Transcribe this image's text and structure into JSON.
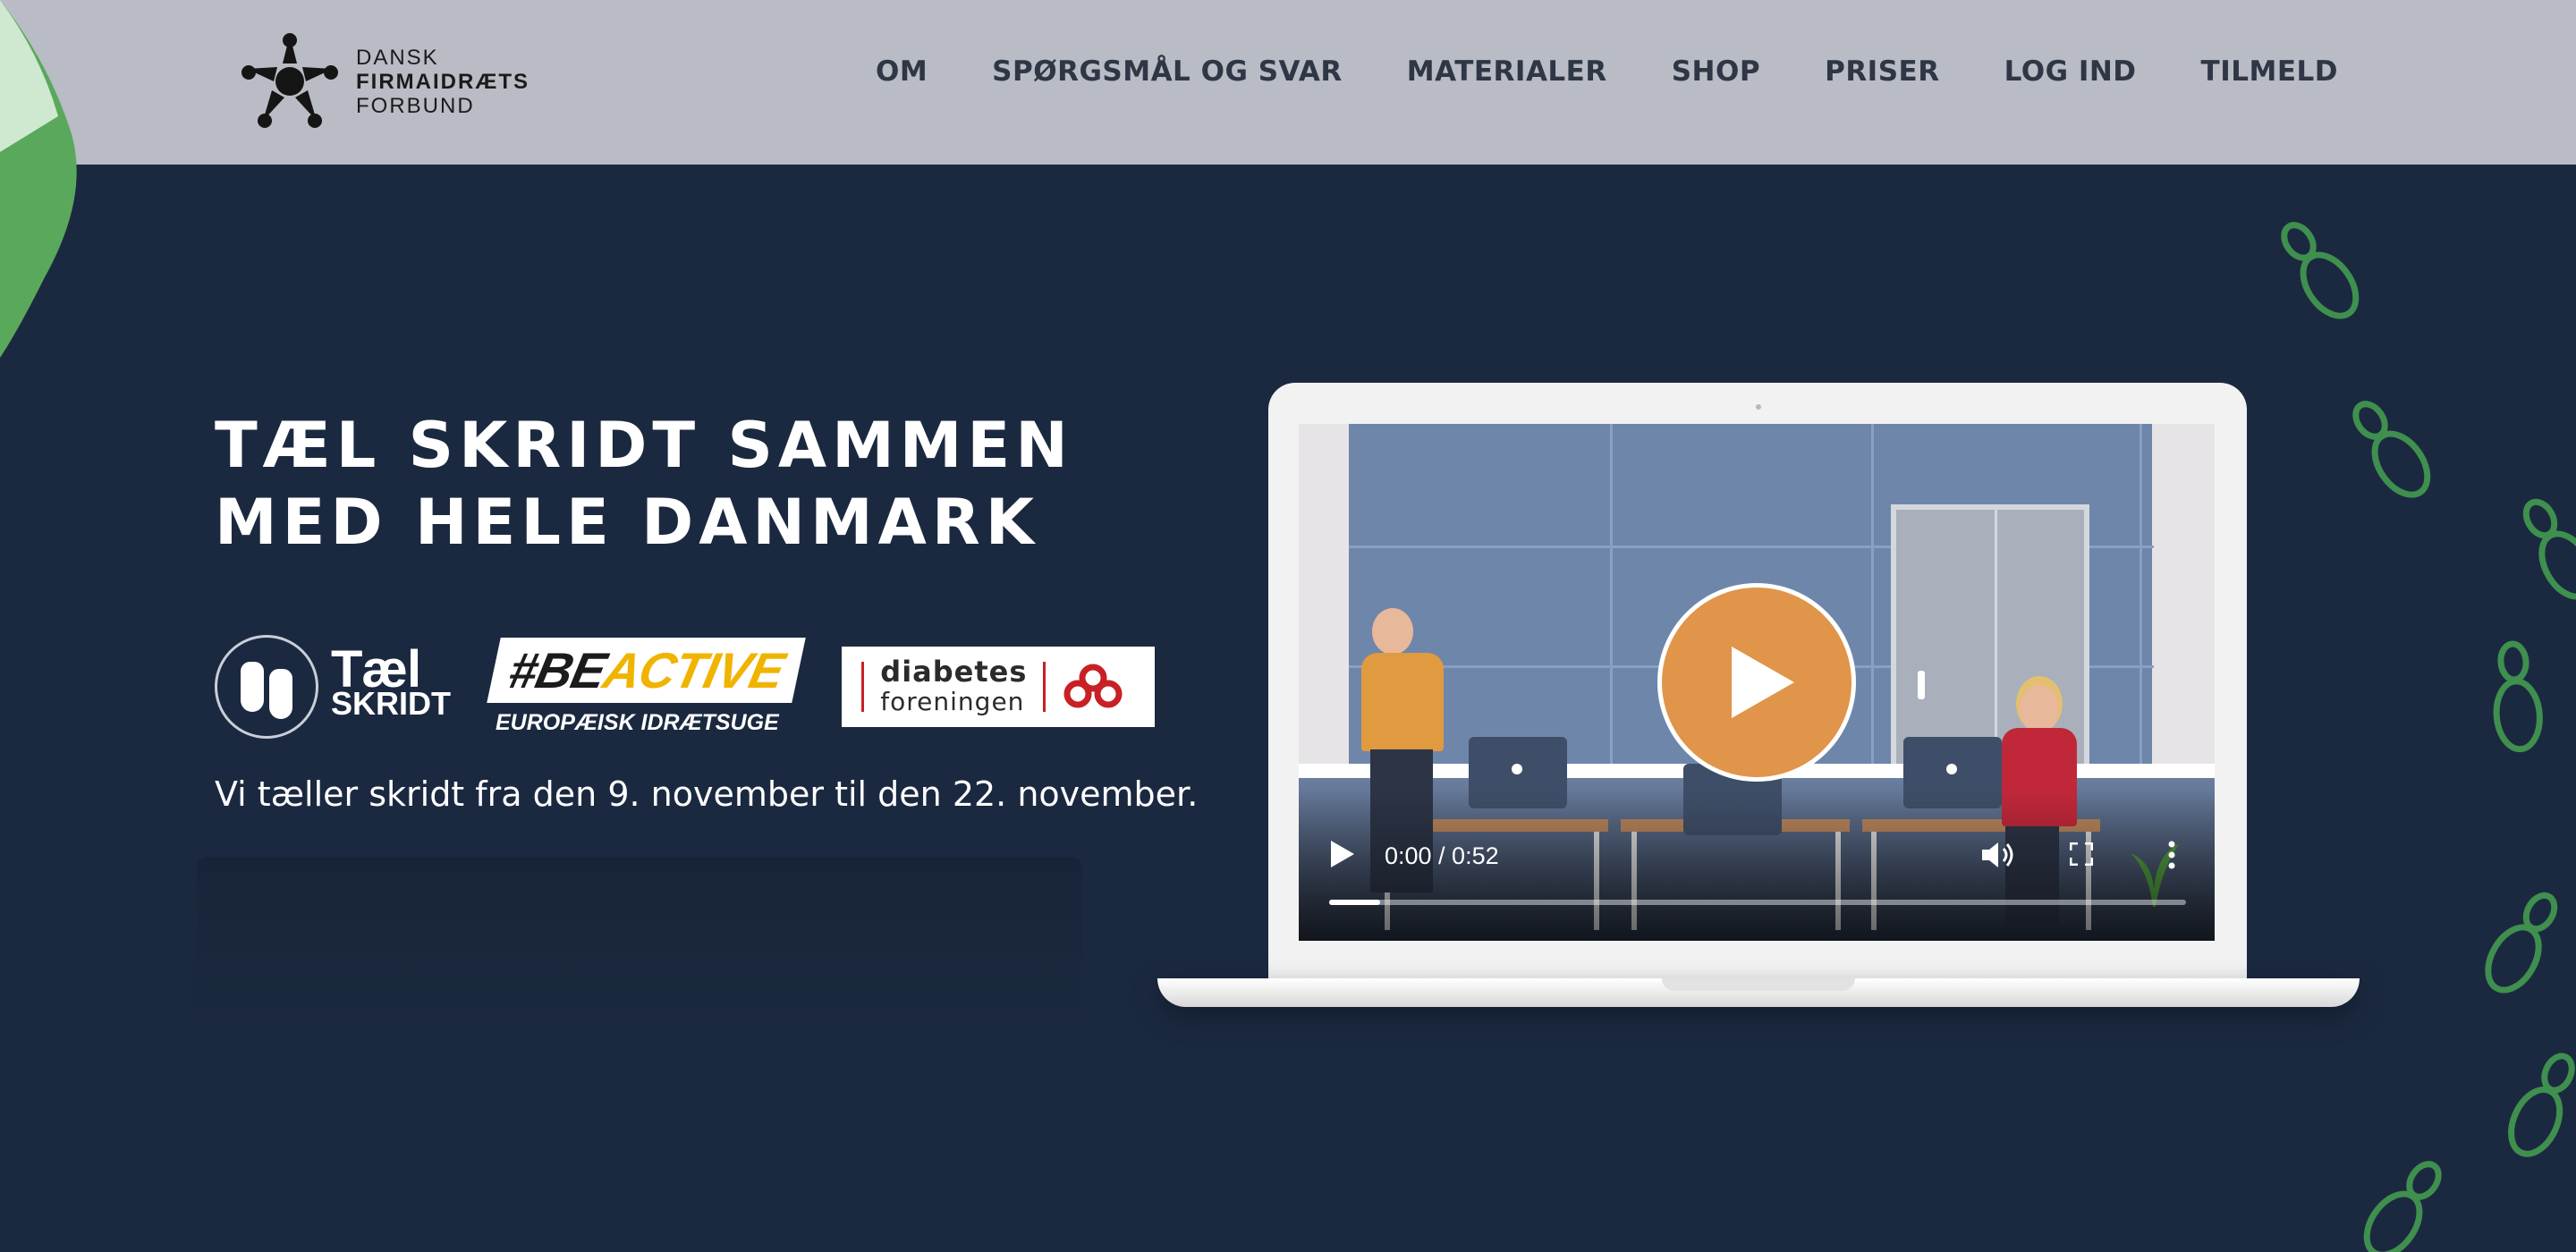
{
  "header": {
    "logo": {
      "line1": "DANSK",
      "line2": "FIRMAIDRÆTS",
      "line3": "FORBUND"
    },
    "nav": [
      {
        "label": "OM"
      },
      {
        "label": "SPØRGSMÅL OG SVAR"
      },
      {
        "label": "MATERIALER"
      },
      {
        "label": "SHOP"
      },
      {
        "label": "PRISER"
      },
      {
        "label": "LOG IND"
      },
      {
        "label": "TILMELD"
      }
    ]
  },
  "hero": {
    "title_line1": "TÆL SKRIDT SAMMEN",
    "title_line2": "MED HELE DANMARK",
    "partners": {
      "tael_line1": "Tæl",
      "tael_line2": "SKRIDT",
      "beactive_hash": "#BE",
      "beactive_word": "ACTIVE",
      "beactive_sub": "EUROPÆISK IDRÆTSUGE",
      "diabetes_line1": "diabetes",
      "diabetes_line2": "foreningen"
    },
    "subline": "Vi tæller skridt fra den 9. november til den 22. november."
  },
  "video": {
    "time": "0:00 / 0:52",
    "progress": 0.06
  },
  "colors": {
    "background": "#1b2940",
    "header": "#b9bcc4",
    "play_button": "#e0954a",
    "footprint": "#3f8f4e",
    "beactive_accent": "#f0b400",
    "diabetes_red": "#c82024"
  },
  "icons": [
    "logo-star-icon",
    "play-icon",
    "volume-icon",
    "fullscreen-icon",
    "more-options-icon",
    "footprint-icon"
  ]
}
